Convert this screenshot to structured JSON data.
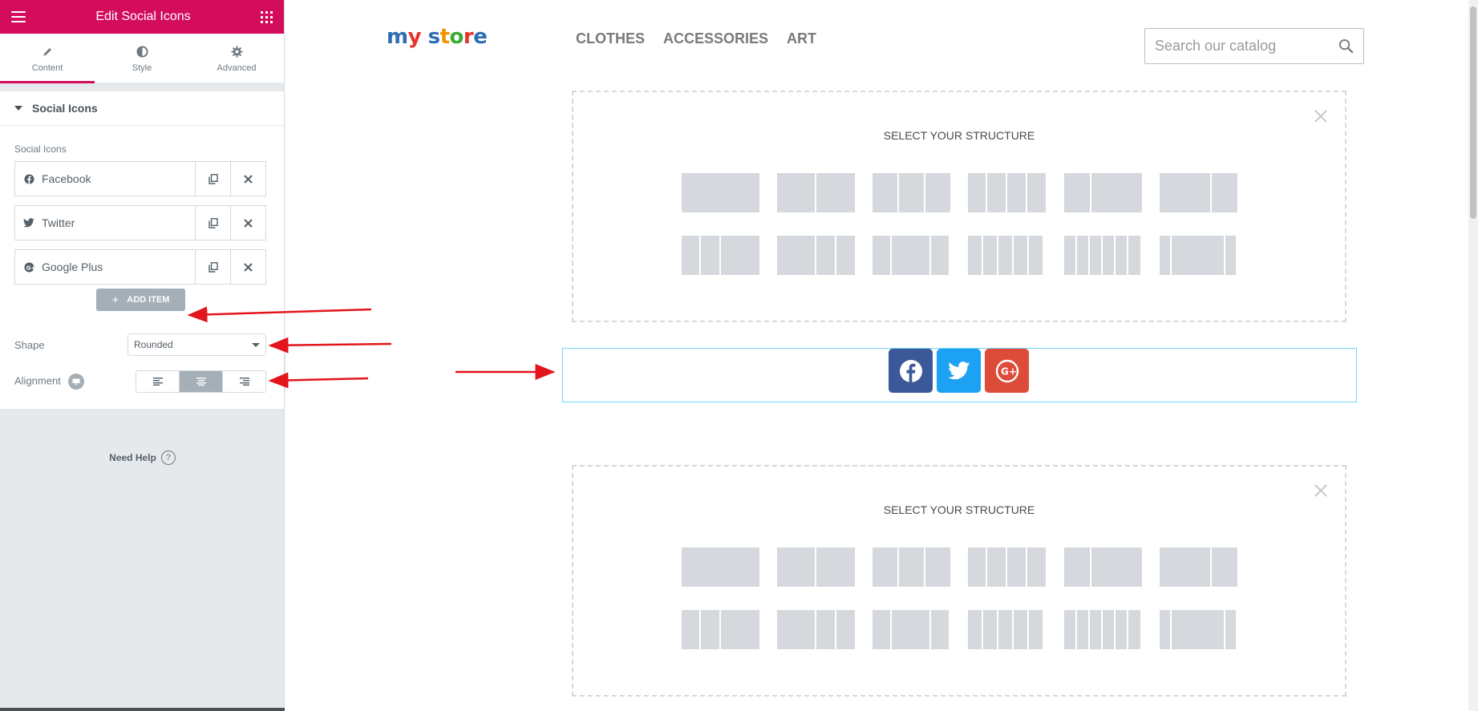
{
  "panel": {
    "title": "Edit Social Icons",
    "tabs": [
      {
        "label": "Content",
        "icon": "pencil-icon"
      },
      {
        "label": "Style",
        "icon": "half-circle-icon"
      },
      {
        "label": "Advanced",
        "icon": "gear-icon"
      }
    ],
    "section_title": "Social Icons",
    "social_icons_label": "Social Icons",
    "items": [
      {
        "label": "Facebook",
        "icon": "facebook-icon"
      },
      {
        "label": "Twitter",
        "icon": "twitter-icon"
      },
      {
        "label": "Google Plus",
        "icon": "google-plus-icon"
      }
    ],
    "add_item_label": "ADD ITEM",
    "shape_label": "Shape",
    "shape_value": "Rounded",
    "alignment_label": "Alignment",
    "alignment_value": "center",
    "need_help_label": "Need Help",
    "accent_color": "#d30c5c"
  },
  "preview": {
    "logo_text": "my store",
    "nav": [
      "CLOTHES",
      "ACCESSORIES",
      "ART"
    ],
    "search_placeholder": "Search our catalog",
    "structure_title": "SELECT YOUR STRUCTURE",
    "social_icons": [
      {
        "name": "facebook",
        "color": "#3b5998"
      },
      {
        "name": "twitter",
        "color": "#1da1f2"
      },
      {
        "name": "google-plus",
        "color": "#dd4b39"
      }
    ]
  }
}
